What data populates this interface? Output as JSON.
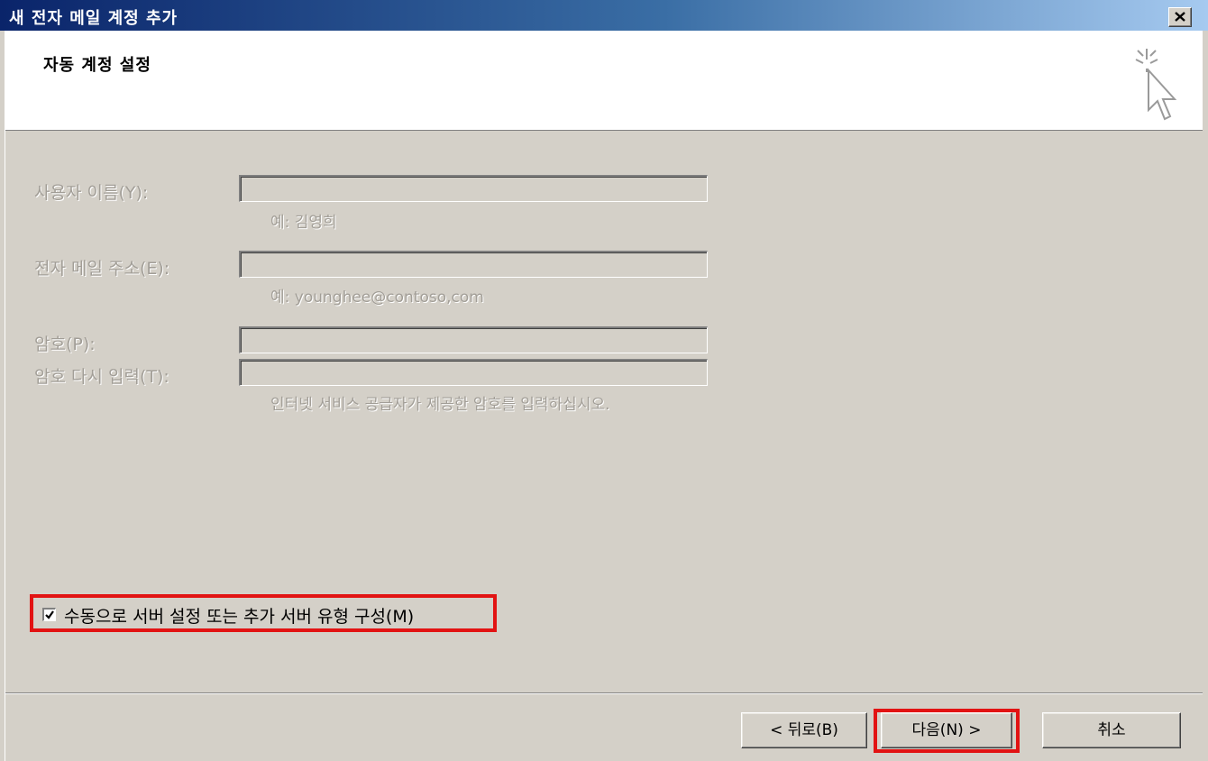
{
  "window": {
    "title": "새 전자 메일 계정 추가",
    "close_symbol": "×"
  },
  "header": {
    "heading": "자동 계정 설정",
    "icon": "wizard-sparkle-cursor-icon"
  },
  "form": {
    "name_label": "사용자 이름(Y):",
    "name_value": "",
    "name_hint": "예: 김영희",
    "email_label": "전자 메일 주소(E):",
    "email_value": "",
    "email_hint": "예: younghee@contoso,com",
    "password_label": "암호(P):",
    "password_value": "",
    "password_confirm_label": "암호 다시 입력(T):",
    "password_confirm_value": "",
    "password_hint": "인터넷 서비스 공급자가 제공한 암호를 입력하십시오."
  },
  "manual_setup": {
    "label": "수동으로 서버 설정 또는 추가 서버 유형 구성(M)",
    "checked": true
  },
  "buttons": {
    "back": "< 뒤로(B)",
    "next": "다음(N) >",
    "cancel": "취소"
  },
  "colors": {
    "highlight": "#e21313",
    "disabled_text": "#a29e97",
    "face": "#d4d0c8"
  }
}
